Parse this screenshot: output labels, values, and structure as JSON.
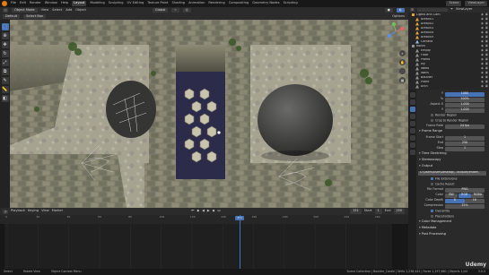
{
  "topbar": {
    "menus": [
      "File",
      "Edit",
      "Render",
      "Window",
      "Help"
    ],
    "workspaces": [
      "Layout",
      "Modeling",
      "Sculpting",
      "UV Editing",
      "Texture Paint",
      "Shading",
      "Animation",
      "Rendering",
      "Compositing",
      "Geometry Nodes",
      "Scripting"
    ],
    "active_workspace": "Layout",
    "scene": "Scene",
    "view_layer": "ViewLayer"
  },
  "viewport_header": {
    "mode": "Object Mode",
    "menus": [
      "View",
      "Select",
      "Add",
      "Object"
    ],
    "orientation": "Global",
    "pivot": "Default",
    "select_box": "Select Box",
    "options": "Options"
  },
  "timeline": {
    "menus": [
      "Playback",
      "Keying",
      "View",
      "Marker"
    ],
    "current_frame": "151",
    "start_label": "Start",
    "start": "1",
    "end_label": "End",
    "end": "250",
    "ruler_ticks": [
      "0",
      "20",
      "40",
      "60",
      "80",
      "100",
      "120",
      "140",
      "160",
      "180",
      "200",
      "220",
      "240"
    ],
    "playhead_frame": 151
  },
  "outliner": {
    "header_label": "ViewLayer",
    "items": [
      {
        "name": "Lights and Cam",
        "color": "#e0a33b",
        "depth": 0
      },
      {
        "name": "Area001",
        "color": "#e0a33b",
        "depth": 1
      },
      {
        "name": "Area002",
        "color": "#e0a33b",
        "depth": 1
      },
      {
        "name": "Area003",
        "color": "#e0a33b",
        "depth": 1
      },
      {
        "name": "Area004",
        "color": "#e0a33b",
        "depth": 1
      },
      {
        "name": "Area005",
        "color": "#e0a33b",
        "depth": 1
      },
      {
        "name": "Camera",
        "color": "#8fb8d9",
        "depth": 1
      },
      {
        "name": "Rocks",
        "color": "#8f8f8f",
        "depth": 0
      },
      {
        "name": "Empty",
        "color": "#8f8f8f",
        "depth": 1
      },
      {
        "name": "Floor",
        "color": "#8f8f8f",
        "depth": 1
      },
      {
        "name": "Plants",
        "color": "#8f8f8f",
        "depth": 1
      },
      {
        "name": "Ivy",
        "color": "#8f8f8f",
        "depth": 1
      },
      {
        "name": "Webs",
        "color": "#8f8f8f",
        "depth": 1
      },
      {
        "name": "Walls",
        "color": "#8f8f8f",
        "depth": 1
      },
      {
        "name": "Boulder",
        "color": "#8f8f8f",
        "depth": 1
      },
      {
        "name": "Plane",
        "color": "#8f8f8f",
        "depth": 1
      },
      {
        "name": "Arch",
        "color": "#8f8f8f",
        "depth": 1
      }
    ]
  },
  "properties": {
    "rows": [
      {
        "type": "field",
        "label": "Y",
        "value": "1080",
        "highlight": true
      },
      {
        "type": "field",
        "label": "%",
        "value": "100%"
      },
      {
        "type": "field",
        "label": "Aspect X",
        "value": "1.000"
      },
      {
        "type": "field",
        "label": "Y",
        "value": "1.000"
      },
      {
        "type": "check",
        "label": "Render Region",
        "on": false
      },
      {
        "type": "check",
        "label": "Crop to Render Region",
        "on": false
      },
      {
        "type": "field",
        "label": "Frame Rate",
        "value": "24 fps"
      },
      {
        "type": "section",
        "label": "Frame Range"
      },
      {
        "type": "field",
        "label": "Frame Start",
        "value": "1"
      },
      {
        "type": "field",
        "label": "End",
        "value": "250"
      },
      {
        "type": "field",
        "label": "Step",
        "value": "1"
      },
      {
        "type": "section",
        "label": "Time Stretching"
      },
      {
        "type": "section",
        "label": "Stereoscopy"
      },
      {
        "type": "section",
        "label": "Output"
      },
      {
        "type": "path",
        "label": "",
        "value": "C:\\Users\\User\\Desktop\\...output\\render\\"
      },
      {
        "type": "check",
        "label": "File Extensions",
        "on": true
      },
      {
        "type": "check",
        "label": "Cache Result",
        "on": false
      },
      {
        "type": "field",
        "label": "File Format",
        "value": "PNG"
      },
      {
        "type": "triple",
        "label": "Color",
        "values": [
          "BW",
          "RGB",
          "RGBA"
        ],
        "active": 1
      },
      {
        "type": "triple",
        "label": "Color Depth",
        "values": [
          "8",
          "16"
        ],
        "active": 0
      },
      {
        "type": "field",
        "label": "Compression",
        "value": "15%"
      },
      {
        "type": "check",
        "label": "Overwrite",
        "on": true
      },
      {
        "type": "check",
        "label": "Placeholders",
        "on": false
      },
      {
        "type": "section",
        "label": "Color Management"
      },
      {
        "type": "section",
        "label": "Metadata"
      },
      {
        "type": "section",
        "label": "Post Processing"
      }
    ]
  },
  "status_bar": {
    "items": [
      "Select",
      "Rotate View",
      "Object Context Menu"
    ],
    "center": "Scene Collection | Boulder_Castle | Verts 1,238,442 | Faces 1,197,660 | Objects 1/44",
    "version": "3.0.0"
  },
  "watermark": "Udemy"
}
